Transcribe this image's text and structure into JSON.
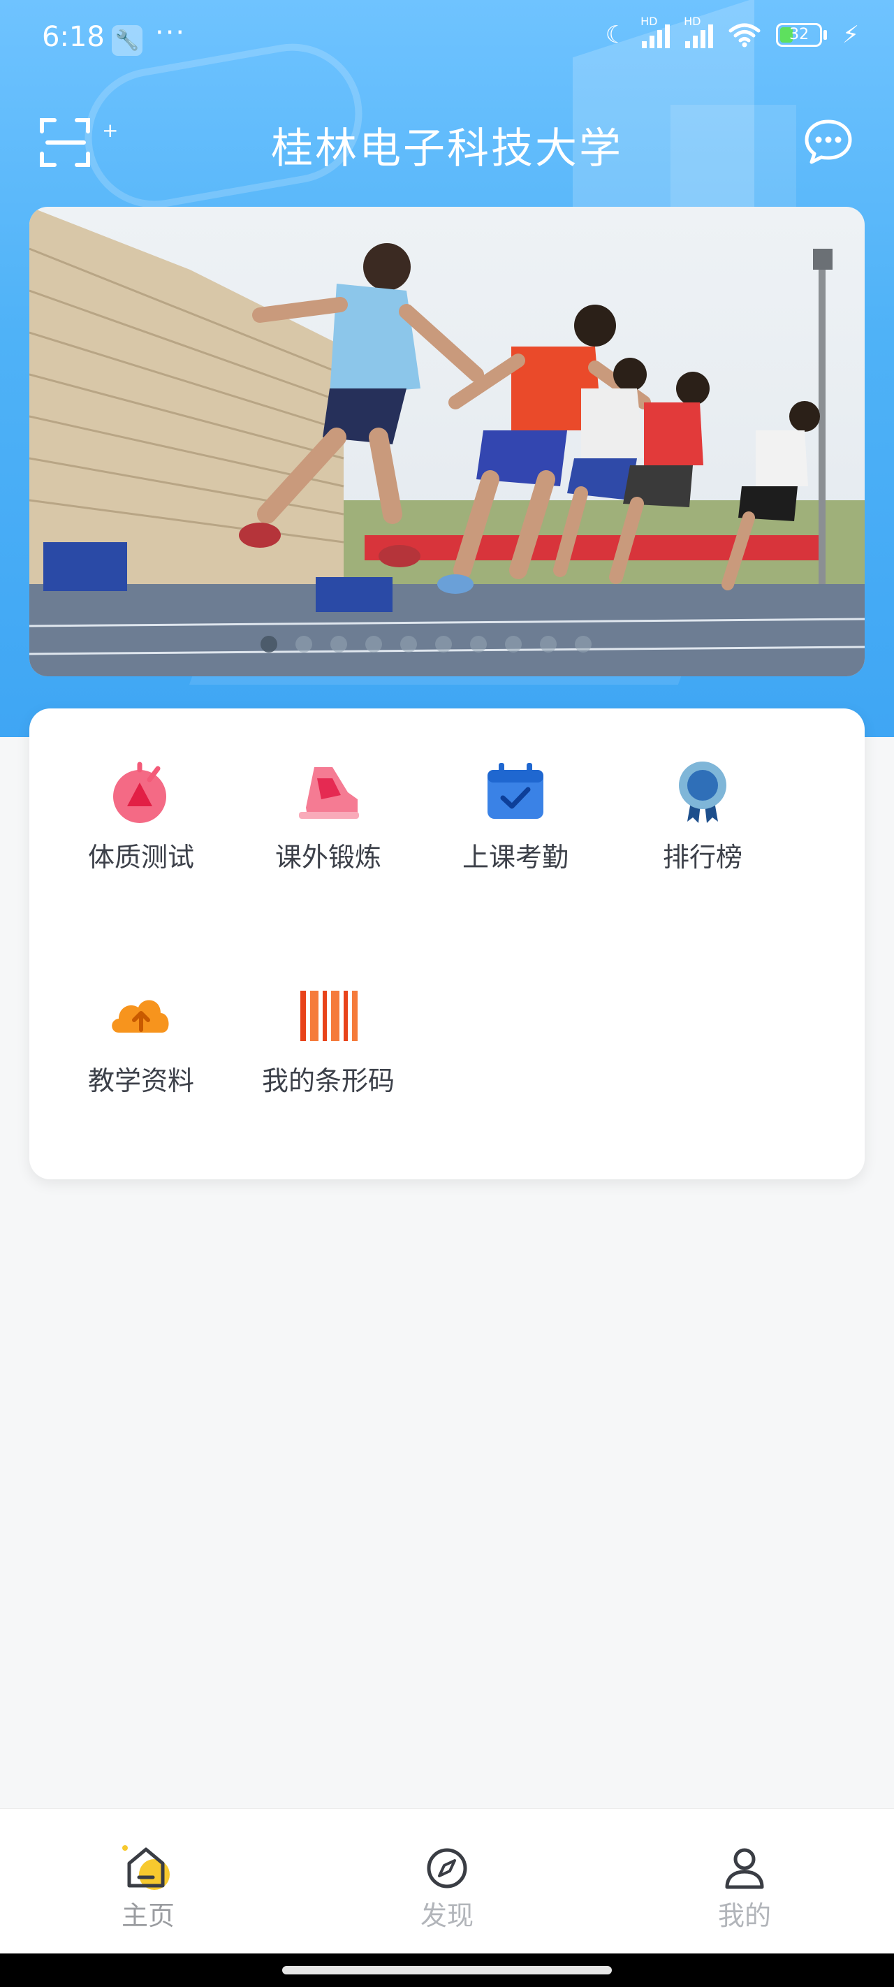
{
  "status_bar": {
    "time": "6:18",
    "more": "···",
    "hd1": "HD",
    "hd2": "HD",
    "battery": "32"
  },
  "header": {
    "title": "桂林电子科技大学",
    "plus": "+"
  },
  "banner": {
    "slide_count": 10,
    "active_index": 0
  },
  "menu": {
    "items": [
      {
        "label": "体质测试",
        "icon": "stopwatch-icon",
        "color": "#f04d6b"
      },
      {
        "label": "课外锻炼",
        "icon": "sneaker-icon",
        "color": "#f25c7a"
      },
      {
        "label": "上课考勤",
        "icon": "calendar-check-icon",
        "color": "#3a82e6"
      },
      {
        "label": "排行榜",
        "icon": "medal-icon",
        "color": "#2f6fb8"
      },
      {
        "label": "教学资料",
        "icon": "cloud-upload-icon",
        "color": "#f7941d"
      },
      {
        "label": "我的条形码",
        "icon": "barcode-icon",
        "color": "#f2541b"
      }
    ]
  },
  "tabbar": {
    "tabs": [
      {
        "label": "主页",
        "icon": "home-icon",
        "active": true
      },
      {
        "label": "发现",
        "icon": "compass-icon",
        "active": false
      },
      {
        "label": "我的",
        "icon": "user-icon",
        "active": false
      }
    ],
    "accent": "#f7c92e"
  }
}
